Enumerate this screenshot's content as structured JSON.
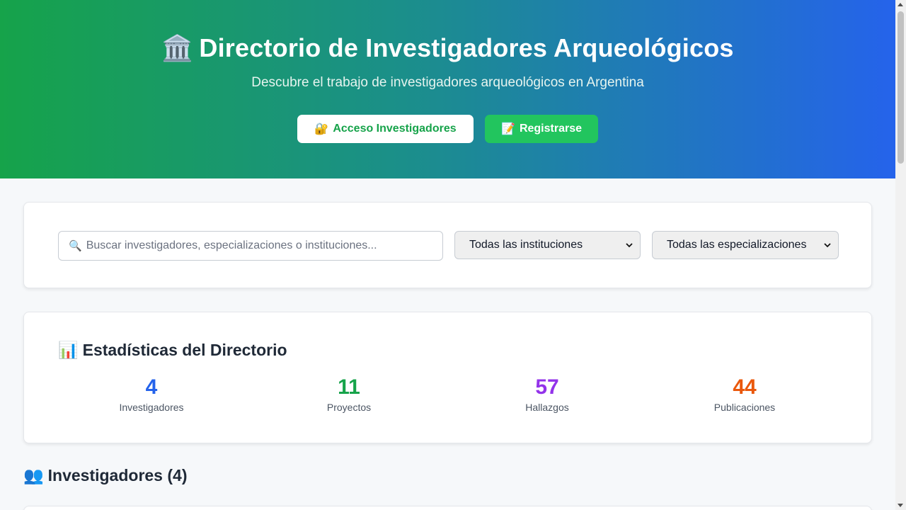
{
  "header": {
    "icon": "🏛️",
    "title": "Directorio de Investigadores Arqueológicos",
    "subtitle": "Descubre el trabajo de investigadores arqueológicos en Argentina",
    "login_icon": "🔐",
    "login_label": "Acceso Investigadores",
    "register_icon": "📝",
    "register_label": "Registrarse"
  },
  "filters": {
    "search_icon": "🔍",
    "search_placeholder": "Buscar investigadores, especializaciones o instituciones...",
    "institution_select": "Todas las instituciones",
    "specialization_select": "Todas las especializaciones"
  },
  "stats": {
    "icon": "📊",
    "title": "Estadísticas del Directorio",
    "items": [
      {
        "value": "4",
        "label": "Investigadores",
        "color": "#2563eb"
      },
      {
        "value": "11",
        "label": "Proyectos",
        "color": "#16a34a"
      },
      {
        "value": "57",
        "label": "Hallazgos",
        "color": "#9333ea"
      },
      {
        "value": "44",
        "label": "Publicaciones",
        "color": "#ea580c"
      }
    ]
  },
  "researchers": {
    "icon": "👥",
    "title": "Investigadores (4)"
  },
  "colors": {
    "gradient_start": "#16a34a",
    "gradient_end": "#2563eb",
    "register_button": "#22c55e"
  }
}
